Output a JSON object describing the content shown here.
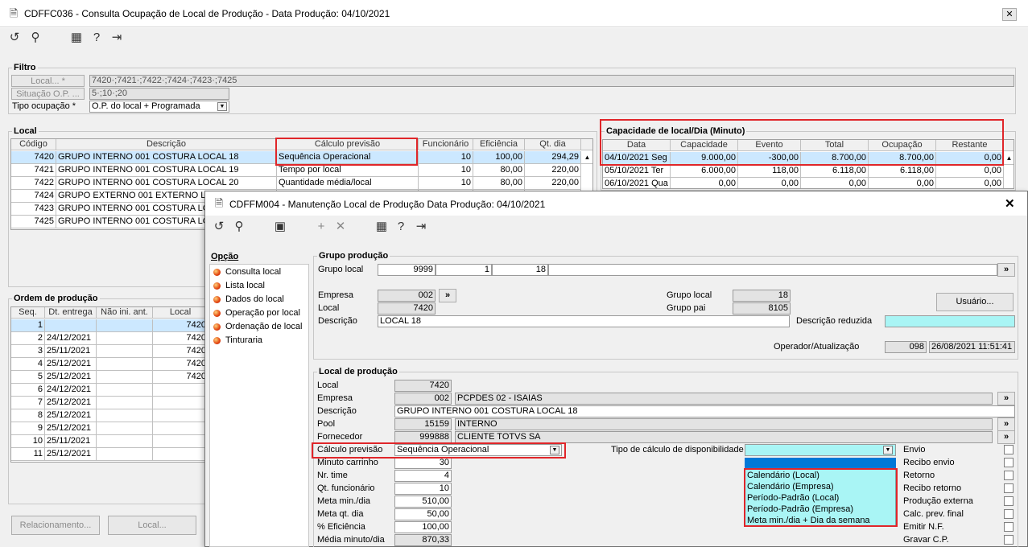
{
  "main": {
    "title": "CDFFC036 - Consulta Ocupação de Local de Produção - Data Produção: 04/10/2021",
    "close_label": "✕",
    "filtro": {
      "title": "Filtro",
      "local_btn": "Local... *",
      "local_value": "7420·;7421·;7422·;7424·;7423·;7425",
      "situacao_btn": "Situação O.P. ...",
      "situacao_value": "5·;10·;20",
      "tipo_label": "Tipo ocupação *",
      "tipo_value": "O.P. do local + Programada"
    },
    "local": {
      "title": "Local",
      "headers": [
        "Código",
        "Descrição",
        "Cálculo previsão",
        "Funcionário",
        "Eficiência",
        "Qt. dia"
      ],
      "rows": [
        [
          "7420",
          "GRUPO INTERNO 001 COSTURA LOCAL 18",
          "Sequência Operacional",
          "10",
          "100,00",
          "294,29"
        ],
        [
          "7421",
          "GRUPO INTERNO 001 COSTURA LOCAL 19",
          "Tempo por local",
          "10",
          "80,00",
          "220,00"
        ],
        [
          "7422",
          "GRUPO INTERNO 001 COSTURA LOCAL 20",
          "Quantidade média/local",
          "10",
          "80,00",
          "220,00"
        ],
        [
          "7424",
          "GRUPO EXTERNO 001 EXTERNO LOC",
          "",
          "",
          "",
          ""
        ],
        [
          "7423",
          "GRUPO INTERNO 001 COSTURA LOC.",
          "",
          "",
          "",
          ""
        ],
        [
          "7425",
          "GRUPO INTERNO 001 COSTURA LOC.",
          "",
          "",
          "",
          ""
        ]
      ]
    },
    "capacidade": {
      "title": "Capacidade de local/Dia (Minuto)",
      "headers": [
        "Data",
        "Capacidade",
        "Evento",
        "Total",
        "Ocupação",
        "Restante"
      ],
      "rows": [
        [
          "04/10/2021 Seg",
          "9.000,00",
          "-300,00",
          "8.700,00",
          "8.700,00",
          "0,00"
        ],
        [
          "05/10/2021 Ter",
          "6.000,00",
          "118,00",
          "6.118,00",
          "6.118,00",
          "0,00"
        ],
        [
          "06/10/2021 Qua",
          "0,00",
          "0,00",
          "0,00",
          "0,00",
          "0,00"
        ]
      ]
    },
    "ordem": {
      "title": "Ordem de produção",
      "headers": [
        "Seq.",
        "Dt. entrega",
        "Não ini. ant.",
        "Local"
      ],
      "rows": [
        [
          "1",
          "",
          "",
          "7420"
        ],
        [
          "2",
          "24/12/2021",
          "",
          "7420"
        ],
        [
          "3",
          "25/11/2021",
          "",
          "7420"
        ],
        [
          "4",
          "25/12/2021",
          "",
          "7420"
        ],
        [
          "5",
          "25/12/2021",
          "",
          "7420"
        ],
        [
          "6",
          "24/12/2021",
          "",
          ""
        ],
        [
          "7",
          "25/12/2021",
          "",
          ""
        ],
        [
          "8",
          "25/12/2021",
          "",
          ""
        ],
        [
          "9",
          "25/12/2021",
          "",
          ""
        ],
        [
          "10",
          "25/11/2021",
          "",
          ""
        ],
        [
          "11",
          "25/12/2021",
          "",
          ""
        ]
      ]
    },
    "relacionamento_btn": "Relacionamento...",
    "local_btn2": "Local..."
  },
  "dialog": {
    "title": "CDFFM004 - Manutenção Local de Produção Data Produção: 04/10/2021",
    "close_label": "✕",
    "opcao_title": "Opção",
    "options": [
      "Consulta local",
      "Lista local",
      "Dados do local",
      "Operação por local",
      "Ordenação de local",
      "Tinturaria"
    ],
    "grupo": {
      "title": "Grupo produção",
      "grupo_local_label": "Grupo local",
      "g1": "9999",
      "g2": "1",
      "g3": "18",
      "empresa_label": "Empresa",
      "empresa": "002",
      "local_label": "Local",
      "local": "7420",
      "descricao_label": "Descrição",
      "descricao": "LOCAL 18",
      "grupo_local2_label": "Grupo local",
      "grupo_local2": "18",
      "grupo_pai_label": "Grupo pai",
      "grupo_pai": "8105",
      "desc_reduzida_label": "Descrição reduzida",
      "usuario_btn": "Usuário...",
      "operador_label": "Operador/Atualização",
      "operador": "098",
      "atualizacao": "26/08/2021 11:51:41"
    },
    "localp": {
      "title": "Local de produção",
      "local_label": "Local",
      "local": "7420",
      "empresa_label": "Empresa",
      "empresa_code": "002",
      "empresa_name": "PCPDES 02 - ISAIAS",
      "descricao_label": "Descrição",
      "descricao": "GRUPO INTERNO 001 COSTURA LOCAL 18",
      "pool_label": "Pool",
      "pool_code": "15159",
      "pool_name": "INTERNO",
      "fornecedor_label": "Fornecedor",
      "fornecedor_code": "999888",
      "fornecedor_name": "CLIENTE TOTVS SA",
      "calculo_label": "Cálculo previsão",
      "calculo_value": "Sequência Operacional",
      "minuto_label": "Minuto carrinho",
      "minuto": "30",
      "nrtime_label": "Nr. time",
      "nrtime": "4",
      "qtfunc_label": "Qt. funcionário",
      "qtfunc": "10",
      "metamin_label": "Meta min./dia",
      "metamin": "510,00",
      "metaqt_label": "Meta qt. dia",
      "metaqt": "50,00",
      "efic_label": "% Eficiência",
      "efic": "100,00",
      "media_label": "Média minuto/dia",
      "media": "870,33",
      "tipo_calc_label": "Tipo de cálculo de disponibilidade",
      "tipo_calc_options": [
        "Calendário (Local)",
        "Calendário (Empresa)",
        "Período-Padrão (Local)",
        "Período-Padrão (Empresa)",
        "Meta min./dia + Dia da semana"
      ],
      "checks": [
        "Envio",
        "Recibo envio",
        "Retorno",
        "Recibo retorno",
        "Produção externa",
        "Calc. prev. final",
        "Emitir N.F.",
        "Gravar C.P."
      ]
    }
  }
}
